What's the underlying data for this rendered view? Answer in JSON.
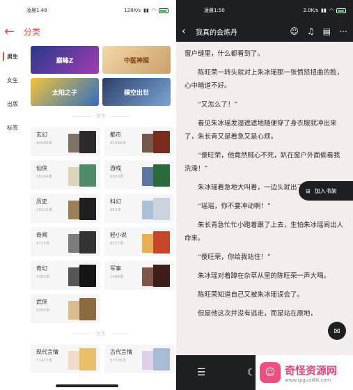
{
  "left": {
    "status": {
      "time": "凌晨1:48",
      "net": "128K/s"
    },
    "topbar": {
      "title": "分类"
    },
    "sidenav": [
      "男生",
      "女生",
      "出版",
      "标签"
    ],
    "banners": [
      "巅峰Z",
      "中医神探",
      "太阳之子",
      "横空出世"
    ],
    "section_male": "男生",
    "section_female": "女生",
    "genres": [
      {
        "name": "玄幻",
        "count": "44908本"
      },
      {
        "name": "都市",
        "count": "41436本"
      },
      {
        "name": "仙侠",
        "count": "16154本"
      },
      {
        "name": "游戏",
        "count": "9309本"
      },
      {
        "name": "历史",
        "count": "10215本"
      },
      {
        "name": "科幻",
        "count": "653本"
      },
      {
        "name": "奇闻",
        "count": "4725本"
      },
      {
        "name": "轻小说",
        "count": "8377本"
      },
      {
        "name": "奇幻",
        "count": "4763本"
      },
      {
        "name": "军事",
        "count": "1446本"
      },
      {
        "name": "武侠",
        "count": "5089本"
      }
    ],
    "female_genres": [
      {
        "name": "现代言情",
        "count": "71477本"
      },
      {
        "name": "古代言情",
        "count": "57705本"
      }
    ]
  },
  "right": {
    "status": {
      "time": "凌晨1:50",
      "net": "2.0K/s"
    },
    "book_title": "我真的会炼丹",
    "paragraphs": [
      "窗户缝里，什么都看到了。",
      "陈旺荣一转头就对上朱冰瑶那一张愤怒扭曲的脸，心中暗道不好。",
      "“又怎么了！”",
      "看见朱冰瑶发湿遮遮地随便穿了身衣服就冲出来了，朱长青又是着急又是心烦。",
      "“傻旺荣，他竟然贼心不死，趴在窗户外面偷看我洗澡！”",
      "朱冰瑶着急地大叫着，一边头就出了门。",
      "“瑶瑶，你不要冲动啊！”",
      "朱长青急忙忙小跑着跟了上去，生怕朱冰瑶闹出人命来。",
      "“傻旺荣，你给我站住！”",
      "朱冰瑶对着蹲在杂草从里的陈旺荣一声大喝。",
      "陈旺荣知道自己又被朱冰瑶误会了。",
      "但是他这次并没有逃走，而是站在原地，"
    ],
    "add_shelf": "加入书架",
    "watermark": {
      "name": "奇怪资源网",
      "url": "www.qiguai88.com"
    }
  }
}
